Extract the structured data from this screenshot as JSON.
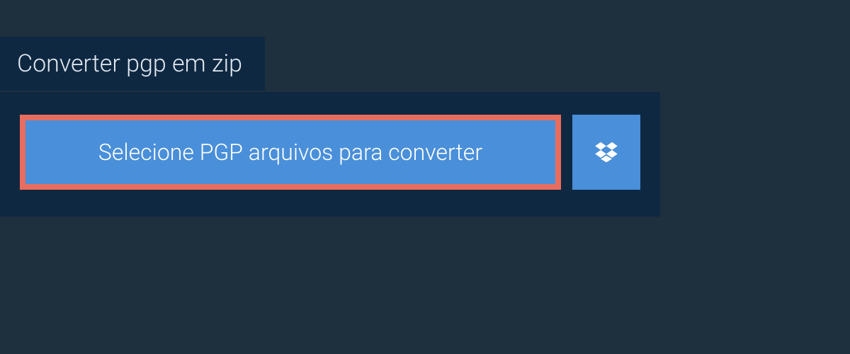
{
  "tab": {
    "title": "Converter pgp em zip"
  },
  "actions": {
    "select_files_label": "Selecione PGP arquivos para converter"
  },
  "colors": {
    "accent": "#4a8fd9",
    "highlight_border": "#e86d5e",
    "panel_bg": "#0f2842",
    "page_bg": "#1e2f3e"
  }
}
